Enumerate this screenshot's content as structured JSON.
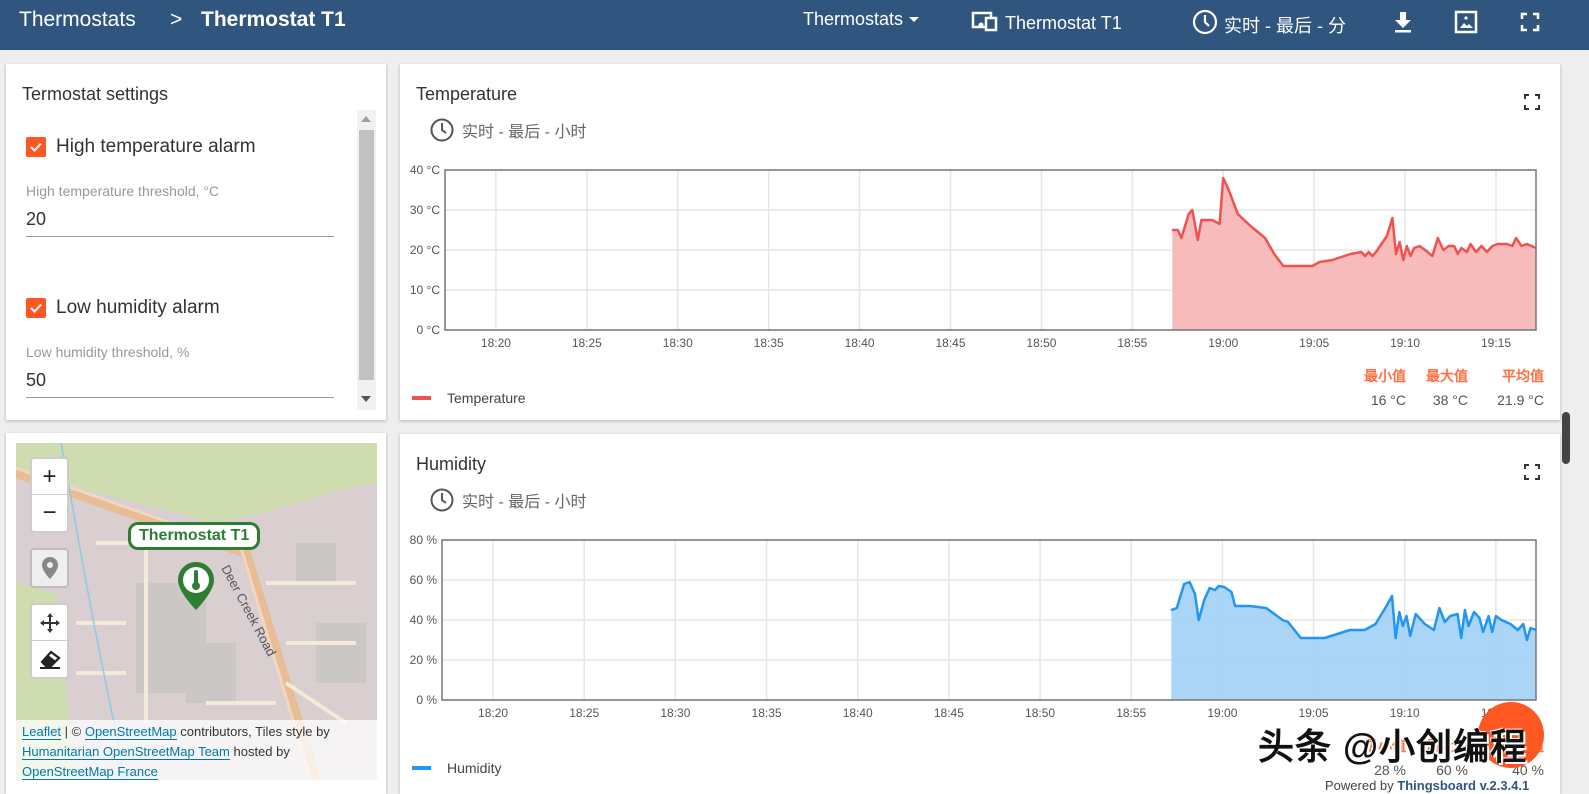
{
  "header": {
    "breadcrumb_root": "Thermostats",
    "breadcrumb_separator": ">",
    "breadcrumb_current": "Thermostat T1",
    "entity_selector": "Thermostats",
    "entity_alias": "Thermostat T1",
    "timewindow": "实时 - 最后 - 分",
    "icons": [
      "download-icon",
      "export-image-icon",
      "fullscreen-icon"
    ],
    "bg_color": "#305680"
  },
  "settings": {
    "title": "Termostat settings",
    "high_temp_alarm": {
      "label": "High temperature alarm",
      "checked": true
    },
    "high_temp_threshold": {
      "label": "High temperature threshold, °C",
      "value": "20"
    },
    "low_hum_alarm": {
      "label": "Low humidity alarm",
      "checked": true
    },
    "low_hum_threshold": {
      "label": "Low humidity threshold, %",
      "value": "50"
    },
    "accent_color": "#ff5722"
  },
  "map": {
    "zoom_in": "+",
    "zoom_out": "−",
    "marker_label": "Thermostat T1",
    "road_label": "Deer Creek Road",
    "attribution": {
      "leaflet": "Leaflet",
      "sep": " | © ",
      "osm": "OpenStreetMap",
      "contributors": " contributors, Tiles style by ",
      "hot": "Humanitarian OpenStreetMap Team",
      "hosted": " hosted by ",
      "osmfr": "OpenStreetMap France"
    }
  },
  "chart_data": [
    {
      "type": "area",
      "title": "Temperature",
      "subtitle": "实时 - 最后 - 小时",
      "unit": "°C",
      "ylim": [
        0,
        40
      ],
      "yticks": [
        "40 °C",
        "30 °C",
        "20 °C",
        "10 °C",
        "0 °C"
      ],
      "ytick_values": [
        40,
        30,
        20,
        10,
        0
      ],
      "xticks": [
        "18:20",
        "18:25",
        "18:30",
        "18:35",
        "18:40",
        "18:45",
        "18:50",
        "18:55",
        "19:00",
        "19:05",
        "19:10",
        "19:15"
      ],
      "xrange_minutes": [
        1097.2,
        1157.2
      ],
      "grid": true,
      "color": "#ef5350",
      "fill": "#f8b7b7",
      "legend": "Temperature",
      "legend_position": "bottom-left",
      "stats_labels": [
        "最小值",
        "最大值",
        "平均值"
      ],
      "stats_values": [
        "16 °C",
        "38 °C",
        "21.9 °C"
      ],
      "points": [
        [
          1137.2,
          25
        ],
        [
          1137.5,
          25
        ],
        [
          1137.7,
          23
        ],
        [
          1138.1,
          29
        ],
        [
          1138.3,
          30
        ],
        [
          1138.6,
          22.5
        ],
        [
          1138.8,
          27.5
        ],
        [
          1139.4,
          27.5
        ],
        [
          1139.6,
          27
        ],
        [
          1139.8,
          26.5
        ],
        [
          1140.0,
          38
        ],
        [
          1140.3,
          35
        ],
        [
          1140.8,
          29
        ],
        [
          1141.5,
          26
        ],
        [
          1142.3,
          23
        ],
        [
          1142.8,
          19
        ],
        [
          1143.3,
          16
        ],
        [
          1144.9,
          16
        ],
        [
          1145.3,
          17
        ],
        [
          1146.0,
          17.5
        ],
        [
          1147.0,
          19
        ],
        [
          1147.6,
          19.5
        ],
        [
          1147.8,
          18.5
        ],
        [
          1148.0,
          19.5
        ],
        [
          1148.2,
          18.5
        ],
        [
          1148.4,
          19.5
        ],
        [
          1149.0,
          23.5
        ],
        [
          1149.3,
          28
        ],
        [
          1149.5,
          19
        ],
        [
          1149.7,
          22
        ],
        [
          1149.9,
          17.5
        ],
        [
          1150.1,
          21
        ],
        [
          1150.3,
          18.5
        ],
        [
          1150.5,
          20.5
        ],
        [
          1150.8,
          21
        ],
        [
          1151.1,
          20
        ],
        [
          1151.5,
          18.5
        ],
        [
          1151.8,
          23
        ],
        [
          1152.1,
          20
        ],
        [
          1152.4,
          21
        ],
        [
          1152.7,
          21
        ],
        [
          1152.9,
          19
        ],
        [
          1153.1,
          20.5
        ],
        [
          1153.4,
          19.5
        ],
        [
          1153.6,
          21.5
        ],
        [
          1153.9,
          19.5
        ],
        [
          1154.2,
          21
        ],
        [
          1154.5,
          19.5
        ],
        [
          1154.8,
          21
        ],
        [
          1155.1,
          21.5
        ],
        [
          1155.6,
          21.5
        ],
        [
          1155.9,
          21
        ],
        [
          1156.1,
          23
        ],
        [
          1156.4,
          21
        ],
        [
          1156.7,
          21.5
        ],
        [
          1157.2,
          20.5
        ]
      ]
    },
    {
      "type": "area",
      "title": "Humidity",
      "subtitle": "实时 - 最后 - 小时",
      "unit": "%",
      "ylim": [
        0,
        80
      ],
      "yticks": [
        "80 %",
        "60 %",
        "40 %",
        "20 %",
        "0 %"
      ],
      "ytick_values": [
        80,
        60,
        40,
        20,
        0
      ],
      "xticks": [
        "18:20",
        "18:25",
        "18:30",
        "18:35",
        "18:40",
        "18:45",
        "18:50",
        "18:55",
        "19:00",
        "19:05",
        "19:10",
        "19:15"
      ],
      "xrange_minutes": [
        1097.2,
        1157.2
      ],
      "grid": true,
      "color": "#2196f3",
      "fill": "#a5d3f6",
      "legend": "Humidity",
      "legend_position": "bottom-left",
      "stats_labels": [
        "最小值",
        "最大值",
        "平均值"
      ],
      "stats_values": [
        "28 %",
        "60 %",
        "40 %"
      ],
      "points": [
        [
          1137.2,
          45
        ],
        [
          1137.5,
          46
        ],
        [
          1137.9,
          58
        ],
        [
          1138.2,
          59
        ],
        [
          1138.5,
          53
        ],
        [
          1138.7,
          40
        ],
        [
          1139.0,
          50
        ],
        [
          1139.3,
          56
        ],
        [
          1139.6,
          55
        ],
        [
          1139.8,
          57
        ],
        [
          1140.1,
          56.5
        ],
        [
          1140.5,
          54
        ],
        [
          1140.7,
          47
        ],
        [
          1141.5,
          47
        ],
        [
          1142.4,
          46
        ],
        [
          1143.3,
          40
        ],
        [
          1143.6,
          39
        ],
        [
          1144.3,
          31
        ],
        [
          1145.6,
          31
        ],
        [
          1146.3,
          33
        ],
        [
          1147.0,
          35
        ],
        [
          1147.8,
          35
        ],
        [
          1148.4,
          38
        ],
        [
          1149.0,
          47
        ],
        [
          1149.3,
          52
        ],
        [
          1149.5,
          31
        ],
        [
          1149.7,
          44
        ],
        [
          1149.9,
          37
        ],
        [
          1150.1,
          42
        ],
        [
          1150.3,
          32
        ],
        [
          1150.6,
          43
        ],
        [
          1151.1,
          38
        ],
        [
          1151.6,
          35
        ],
        [
          1151.9,
          46
        ],
        [
          1152.2,
          39
        ],
        [
          1152.5,
          42
        ],
        [
          1152.9,
          43
        ],
        [
          1153.1,
          31
        ],
        [
          1153.3,
          45
        ],
        [
          1153.5,
          37
        ],
        [
          1153.8,
          44
        ],
        [
          1154.1,
          41
        ],
        [
          1154.3,
          34
        ],
        [
          1154.6,
          42
        ],
        [
          1154.8,
          34
        ],
        [
          1155.0,
          42
        ],
        [
          1155.3,
          40
        ],
        [
          1155.8,
          38
        ],
        [
          1156.2,
          35
        ],
        [
          1156.5,
          38
        ],
        [
          1156.7,
          30
        ],
        [
          1156.9,
          36
        ],
        [
          1157.2,
          35
        ]
      ]
    }
  ],
  "overlay": {
    "watermark": "头条 @小创编程",
    "powered_prefix": "Powered by ",
    "powered_link": "Thingsboard v.2.3.4.1"
  }
}
